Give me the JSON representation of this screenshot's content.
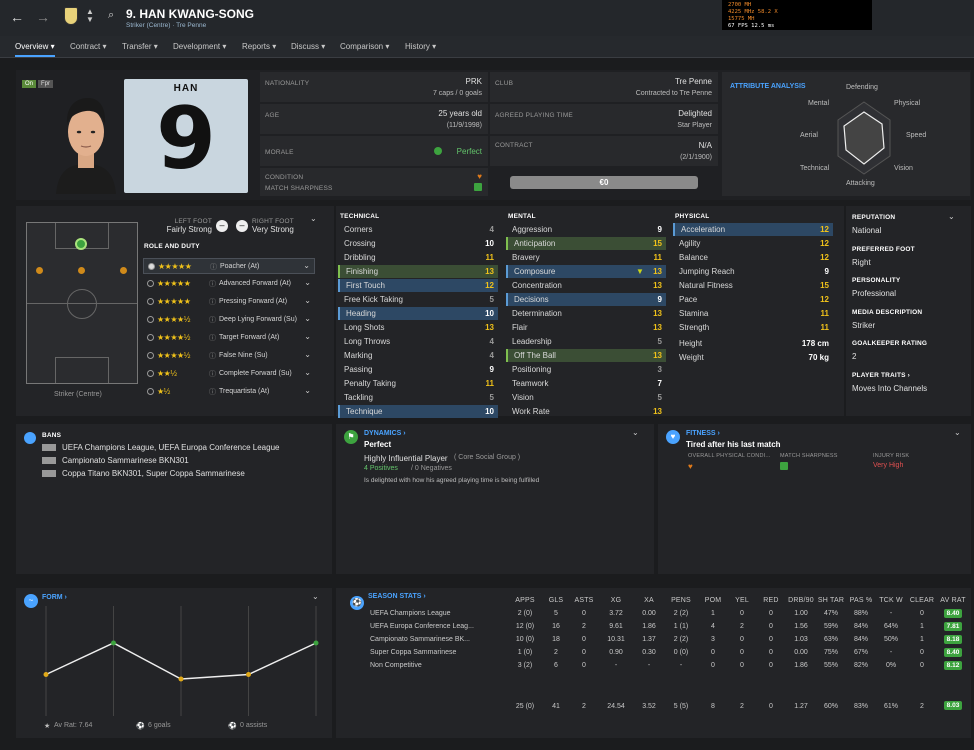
{
  "header": {
    "title": "9. HAN KWANG-SONG",
    "subtitle": "Striker (Centre) · Tre Penne",
    "perf_lines": [
      "2700 MH",
      "4225 MHz  58.2 X",
      "15775 MH",
      "67 FPS  12.5 ms"
    ]
  },
  "nav": {
    "items": [
      "Overview",
      "Contract",
      "Transfer",
      "Development",
      "Reports",
      "Discuss",
      "Comparison",
      "History"
    ]
  },
  "player": {
    "shirt_name": "HAN",
    "number": "9",
    "tags": [
      "On",
      "Fpr"
    ],
    "nationality_label": "NATIONALITY",
    "nationality": "PRK",
    "caps": "7 caps / 0 goals",
    "age_label": "AGE",
    "age": "25 years old",
    "dob": "(11/9/1998)",
    "morale_label": "MORALE",
    "morale": "Perfect",
    "condition_label": "CONDITION",
    "sharpness_label": "MATCH SHARPNESS",
    "club_label": "CLUB",
    "club": "Tre Penne",
    "club_status": "Contracted to Tre Penne",
    "playing_time_label": "AGREED PLAYING TIME",
    "playing_time": "Delighted",
    "playing_time_role": "Star Player",
    "contract_label": "CONTRACT",
    "contract": "N/A",
    "contract_date": "(2/1/1900)",
    "value": "€0"
  },
  "analysis": {
    "title": "ATTRIBUTE ANALYSIS",
    "labels": [
      "Defending",
      "Physical",
      "Speed",
      "Vision",
      "Attacking",
      "Technical",
      "Aerial",
      "Mental"
    ]
  },
  "position": {
    "left_foot_label": "LEFT FOOT",
    "left_foot": "Fairly Strong",
    "right_foot_label": "RIGHT FOOT",
    "right_foot": "Very Strong",
    "role_duty_label": "ROLE AND DUTY",
    "pitch_caption": "Striker (Centre)",
    "roles": [
      {
        "name": "Poacher (At)",
        "stars": "★★★★★"
      },
      {
        "name": "Advanced Forward (At)",
        "stars": "★★★★★"
      },
      {
        "name": "Pressing Forward (At)",
        "stars": "★★★★★"
      },
      {
        "name": "Deep Lying Forward (Su)",
        "stars": "★★★★½"
      },
      {
        "name": "Target Forward (At)",
        "stars": "★★★★½"
      },
      {
        "name": "False Nine (Su)",
        "stars": "★★★★½"
      },
      {
        "name": "Complete Forward (Su)",
        "stars": "★★½"
      },
      {
        "name": "Trequartista (At)",
        "stars": "★½"
      }
    ]
  },
  "attributes": {
    "technical_title": "TECHNICAL",
    "mental_title": "MENTAL",
    "physical_title": "PHYSICAL",
    "technical": [
      [
        "Corners",
        "4"
      ],
      [
        "Crossing",
        "10"
      ],
      [
        "Dribbling",
        "11"
      ],
      [
        "Finishing",
        "13"
      ],
      [
        "First Touch",
        "12"
      ],
      [
        "Free Kick Taking",
        "5"
      ],
      [
        "Heading",
        "10"
      ],
      [
        "Long Shots",
        "13"
      ],
      [
        "Long Throws",
        "4"
      ],
      [
        "Marking",
        "4"
      ],
      [
        "Passing",
        "9"
      ],
      [
        "Penalty Taking",
        "11"
      ],
      [
        "Tackling",
        "5"
      ],
      [
        "Technique",
        "10"
      ]
    ],
    "mental": [
      [
        "Aggression",
        "9"
      ],
      [
        "Anticipation",
        "15"
      ],
      [
        "Bravery",
        "11"
      ],
      [
        "Composure",
        "13"
      ],
      [
        "Concentration",
        "13"
      ],
      [
        "Decisions",
        "9"
      ],
      [
        "Determination",
        "13"
      ],
      [
        "Flair",
        "13"
      ],
      [
        "Leadership",
        "5"
      ],
      [
        "Off The Ball",
        "13"
      ],
      [
        "Positioning",
        "3"
      ],
      [
        "Teamwork",
        "7"
      ],
      [
        "Vision",
        "5"
      ],
      [
        "Work Rate",
        "13"
      ]
    ],
    "physical": [
      [
        "Acceleration",
        "12"
      ],
      [
        "Agility",
        "12"
      ],
      [
        "Balance",
        "12"
      ],
      [
        "Jumping Reach",
        "9"
      ],
      [
        "Natural Fitness",
        "15"
      ],
      [
        "Pace",
        "12"
      ],
      [
        "Stamina",
        "11"
      ],
      [
        "Strength",
        "11"
      ],
      [
        "Height",
        "178 cm"
      ],
      [
        "Weight",
        "70 kg"
      ]
    ]
  },
  "info": {
    "reputation_label": "REPUTATION",
    "reputation": "National",
    "preferred_foot_label": "PREFERRED FOOT",
    "preferred_foot": "Right",
    "personality_label": "PERSONALITY",
    "personality": "Professional",
    "media_label": "MEDIA DESCRIPTION",
    "media": "Striker",
    "gk_label": "GOALKEEPER RATING",
    "gk": "2",
    "traits_label": "PLAYER TRAITS",
    "traits": "Moves Into Channels"
  },
  "bans": {
    "title": "BANS",
    "items": [
      "UEFA Champions League, UEFA Europa Conference League",
      "Campionato Sammarinese BKN301",
      "Coppa Titano BKN301, Super Coppa Sammarinese"
    ]
  },
  "dynamics": {
    "title": "DYNAMICS",
    "status": "Perfect",
    "influence": "Highly Influential Player",
    "group": "( Core Social Group )",
    "positives": "4 Positives",
    "negatives": "/ 0 Negatives",
    "note": "Is delighted with how his agreed playing time is being fulfilled"
  },
  "fitness": {
    "title": "FITNESS",
    "status": "Tired after his last match",
    "overall_label": "OVERALL PHYSICAL CONDI...",
    "sharpness_label": "MATCH SHARPNESS",
    "injury_label": "INJURY RISK",
    "injury": "Very High"
  },
  "form": {
    "title": "FORM",
    "av_rat": "Av Rat: 7.64",
    "goals": "6 goals",
    "assists": "0 assists",
    "points": [
      7.2,
      7.9,
      7.1,
      7.2,
      7.9
    ]
  },
  "season": {
    "title": "SEASON STATS",
    "columns": [
      "APPS",
      "GLS",
      "ASTS",
      "XG",
      "XA",
      "PENS",
      "POM",
      "YEL",
      "RED",
      "DRB/90",
      "SH TAR",
      "PAS %",
      "TCK W",
      "CLEAR",
      "AV RAT"
    ],
    "rows": [
      {
        "name": "UEFA Champions League",
        "cells": [
          "2 (0)",
          "5",
          "0",
          "3.72",
          "0.00",
          "2 (2)",
          "1",
          "0",
          "0",
          "1.00",
          "47%",
          "88%",
          "-",
          "0",
          "8.40"
        ]
      },
      {
        "name": "UEFA Europa Conference Leag...",
        "cells": [
          "12 (0)",
          "16",
          "2",
          "9.61",
          "1.86",
          "1 (1)",
          "4",
          "2",
          "0",
          "1.56",
          "59%",
          "84%",
          "64%",
          "1",
          "7.81"
        ]
      },
      {
        "name": "Campionato Sammarinese BK...",
        "cells": [
          "10 (0)",
          "18",
          "0",
          "10.31",
          "1.37",
          "2 (2)",
          "3",
          "0",
          "0",
          "1.03",
          "63%",
          "84%",
          "50%",
          "1",
          "8.18"
        ]
      },
      {
        "name": "Super Coppa Sammarinese",
        "cells": [
          "1 (0)",
          "2",
          "0",
          "0.90",
          "0.30",
          "0 (0)",
          "0",
          "0",
          "0",
          "0.00",
          "75%",
          "67%",
          "-",
          "0",
          "8.40"
        ]
      },
      {
        "name": "Non Competitive",
        "cells": [
          "3 (2)",
          "6",
          "0",
          "-",
          "-",
          "-",
          "0",
          "0",
          "0",
          "1.86",
          "55%",
          "82%",
          "0%",
          "0",
          "8.12"
        ]
      }
    ],
    "total": [
      "25 (0)",
      "41",
      "2",
      "24.54",
      "3.52",
      "5 (5)",
      "8",
      "2",
      "0",
      "1.27",
      "60%",
      "83%",
      "61%",
      "2",
      "8.03"
    ]
  }
}
